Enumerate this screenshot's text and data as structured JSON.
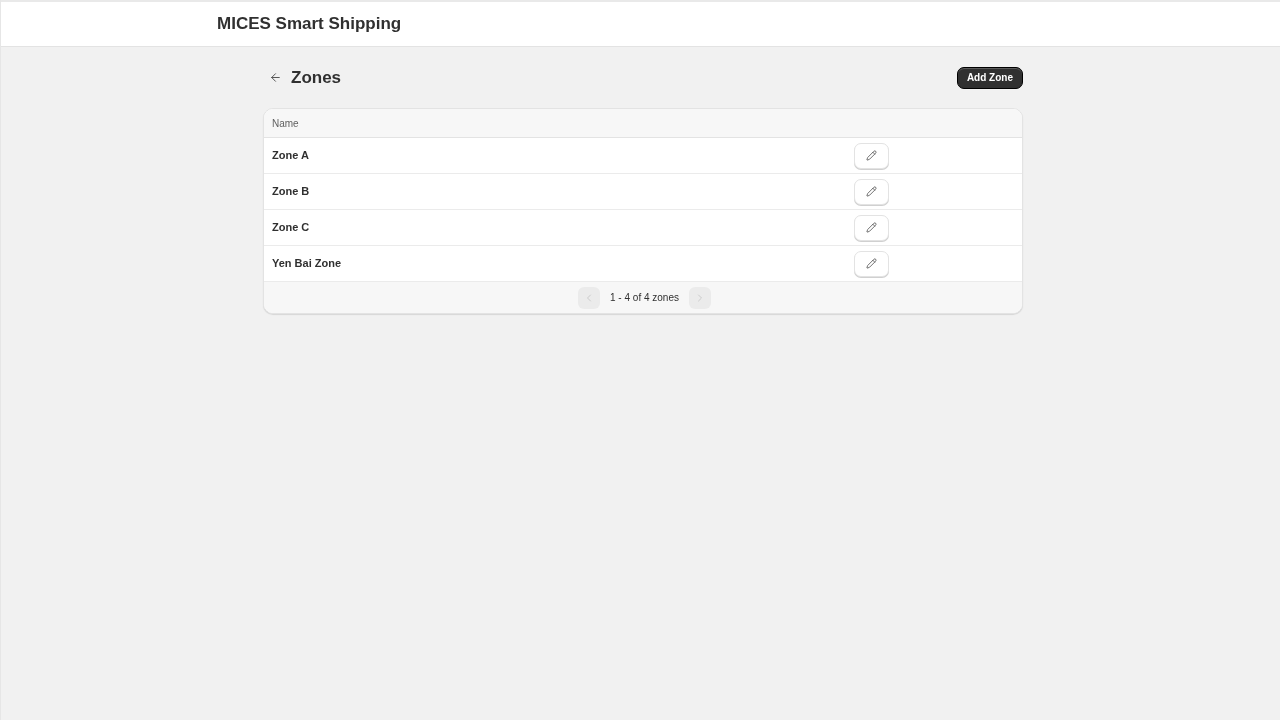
{
  "app_bar": {
    "title": "MICES Smart Shipping"
  },
  "page": {
    "title": "Zones",
    "primary_action": "Add Zone"
  },
  "table": {
    "columns": [
      "Name"
    ],
    "rows": [
      {
        "name": "Zone A"
      },
      {
        "name": "Zone B"
      },
      {
        "name": "Zone C"
      },
      {
        "name": "Yen Bai Zone"
      }
    ]
  },
  "pagination": {
    "previous": {
      "disabled": true
    },
    "label": "1 - 4 of 4 zones",
    "next": {
      "disabled": true
    }
  }
}
